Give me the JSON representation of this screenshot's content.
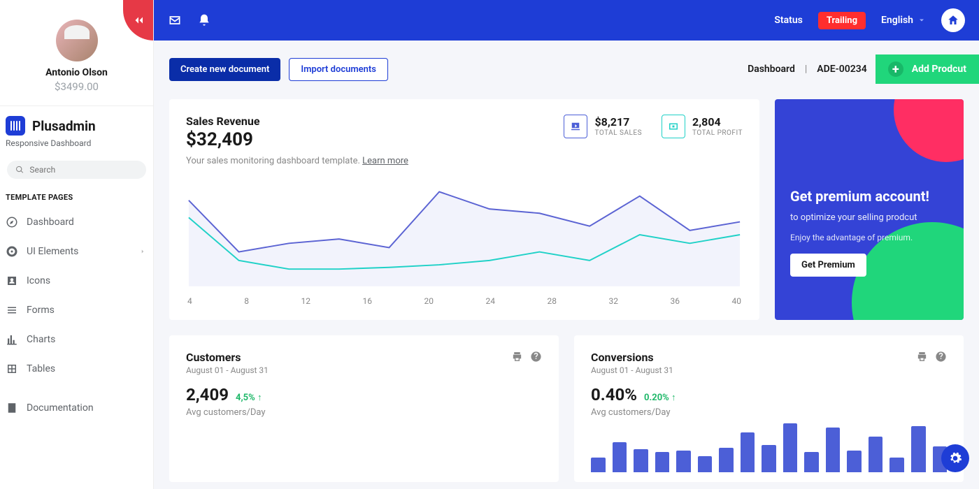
{
  "profile": {
    "name": "Antonio Olson",
    "balance": "$3499.00"
  },
  "brand": {
    "name": "Plusadmin",
    "subtitle": "Responsive Dashboard"
  },
  "search": {
    "placeholder": "Search"
  },
  "sidebar": {
    "section_label": "TEMPLATE PAGES",
    "items": [
      {
        "label": "Dashboard"
      },
      {
        "label": "UI Elements"
      },
      {
        "label": "Icons"
      },
      {
        "label": "Forms"
      },
      {
        "label": "Charts"
      },
      {
        "label": "Tables"
      },
      {
        "label": "Documentation"
      }
    ]
  },
  "topbar": {
    "status": "Status",
    "trailing": "Trailing",
    "language": "English"
  },
  "actions": {
    "create": "Create new document",
    "import": "Import documents",
    "add_product": "Add Prodcut"
  },
  "breadcrumb": {
    "dashboard": "Dashboard",
    "code": "ADE-00234"
  },
  "revenue": {
    "title": "Sales Revenue",
    "value": "$32,409",
    "subtitle": "Your sales monitoring dashboard template.",
    "learn_more": "Learn more",
    "total_sales": {
      "value": "$8,217",
      "label": "TOTAL SALES"
    },
    "total_profit": {
      "value": "2,804",
      "label": "TOTAL PROFIT"
    }
  },
  "promo": {
    "title": "Get premium account!",
    "line1": "to optimize your selling prodcut",
    "line2": "Enjoy the advantage of premium.",
    "cta": "Get Premium"
  },
  "customers": {
    "title": "Customers",
    "range": "August 01 - August 31",
    "value": "2,409",
    "delta": "4,5% ↑",
    "sub": "Avg customers/Day"
  },
  "conversions": {
    "title": "Conversions",
    "range": "August 01 - August 31",
    "value": "0.40%",
    "delta": "0.20% ↑",
    "sub": "Avg customers/Day"
  },
  "chart_data": {
    "type": "line",
    "x": [
      4,
      8,
      12,
      16,
      20,
      24,
      28,
      32,
      36,
      40
    ],
    "xlabel": "",
    "ylabel": "",
    "series": [
      {
        "name": "revenue",
        "color": "#5b63d3",
        "values": [
          140,
          80,
          90,
          95,
          85,
          150,
          130,
          125,
          110,
          145,
          105,
          115
        ]
      },
      {
        "name": "profit",
        "color": "#1fd1c7",
        "values": [
          120,
          70,
          60,
          60,
          62,
          65,
          70,
          80,
          70,
          100,
          90,
          100
        ]
      }
    ],
    "ylim": [
      40,
      160
    ]
  },
  "bar_data": {
    "type": "bar",
    "values": [
      20,
      42,
      32,
      28,
      30,
      22,
      34,
      55,
      38,
      68,
      28,
      62,
      30,
      50,
      20,
      64,
      36
    ]
  }
}
